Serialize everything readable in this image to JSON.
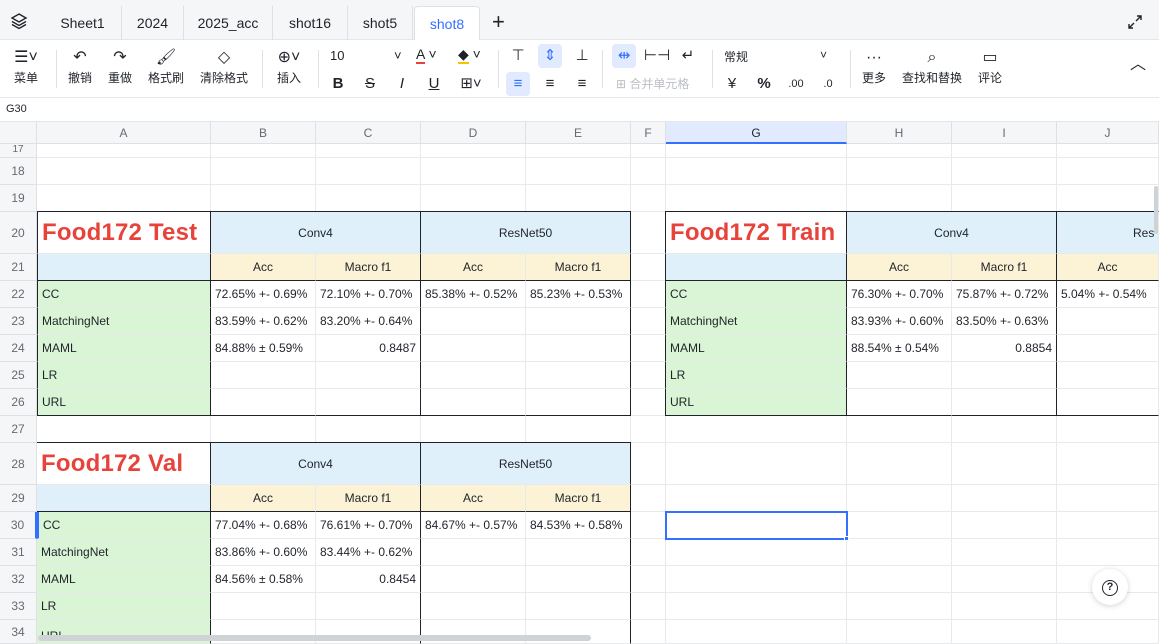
{
  "tabs": [
    {
      "label": "Sheet1"
    },
    {
      "label": "2024"
    },
    {
      "label": "2025_acc"
    },
    {
      "label": "shot16"
    },
    {
      "label": "shot5"
    },
    {
      "label": "shot8"
    }
  ],
  "add_tab": "+",
  "toolbar": {
    "menu": "菜单",
    "undo": "撤销",
    "redo": "重做",
    "format_painter": "格式刷",
    "clear_format": "清除格式",
    "insert": "插入",
    "font_size": "10",
    "merge": "合并单元格",
    "number_format": "常规",
    "currency": "¥",
    "percent": "%",
    "more": "更多",
    "find_replace": "查找和替换",
    "comment": "评论"
  },
  "name_box": "G30",
  "columns": [
    "A",
    "B",
    "C",
    "D",
    "E",
    "F",
    "G",
    "H",
    "I",
    "J"
  ],
  "rows": [
    "17",
    "18",
    "19",
    "20",
    "21",
    "22",
    "23",
    "24",
    "25",
    "26",
    "27",
    "28",
    "29",
    "30",
    "31",
    "32",
    "33",
    "34"
  ],
  "test": {
    "title": "Food172 Test",
    "conv4": "Conv4",
    "resnet50": "ResNet50",
    "acc": "Acc",
    "macro": "Macro f1",
    "labels": [
      "CC",
      "MatchingNet",
      "MAML",
      "LR",
      "URL"
    ],
    "cc": [
      "72.65% +- 0.69%",
      "72.10% +- 0.70%",
      "85.38% +- 0.52%",
      "85.23% +- 0.53%"
    ],
    "matching": [
      "83.59% +- 0.62%",
      "83.20% +- 0.64%"
    ],
    "maml": [
      "84.88% ± 0.59%",
      "0.8487"
    ]
  },
  "train": {
    "title": "Food172 Train",
    "conv4": "Conv4",
    "resnet50": "Res",
    "acc": "Acc",
    "macro": "Macro f1",
    "labels": [
      "CC",
      "MatchingNet",
      "MAML",
      "LR",
      "URL"
    ],
    "cc": [
      "76.30% +- 0.70%",
      "75.87% +- 0.72%",
      "5.04% +- 0.54%"
    ],
    "matching": [
      "83.93% +- 0.60%",
      "83.50% +- 0.63%"
    ],
    "maml": [
      "88.54% ± 0.54%",
      "0.8854"
    ]
  },
  "val": {
    "title": "Food172 Val",
    "conv4": "Conv4",
    "resnet50": "ResNet50",
    "acc": "Acc",
    "macro": "Macro f1",
    "labels": [
      "CC",
      "MatchingNet",
      "MAML",
      "LR",
      "URL"
    ],
    "cc": [
      "77.04% +- 0.68%",
      "76.61% +- 0.70%",
      "84.67% +- 0.57%",
      "84.53% +- 0.58%"
    ],
    "matching": [
      "83.86% +- 0.60%",
      "83.44% +- 0.62%"
    ],
    "maml": [
      "84.56% ± 0.58%",
      "0.8454"
    ]
  },
  "help": "?"
}
